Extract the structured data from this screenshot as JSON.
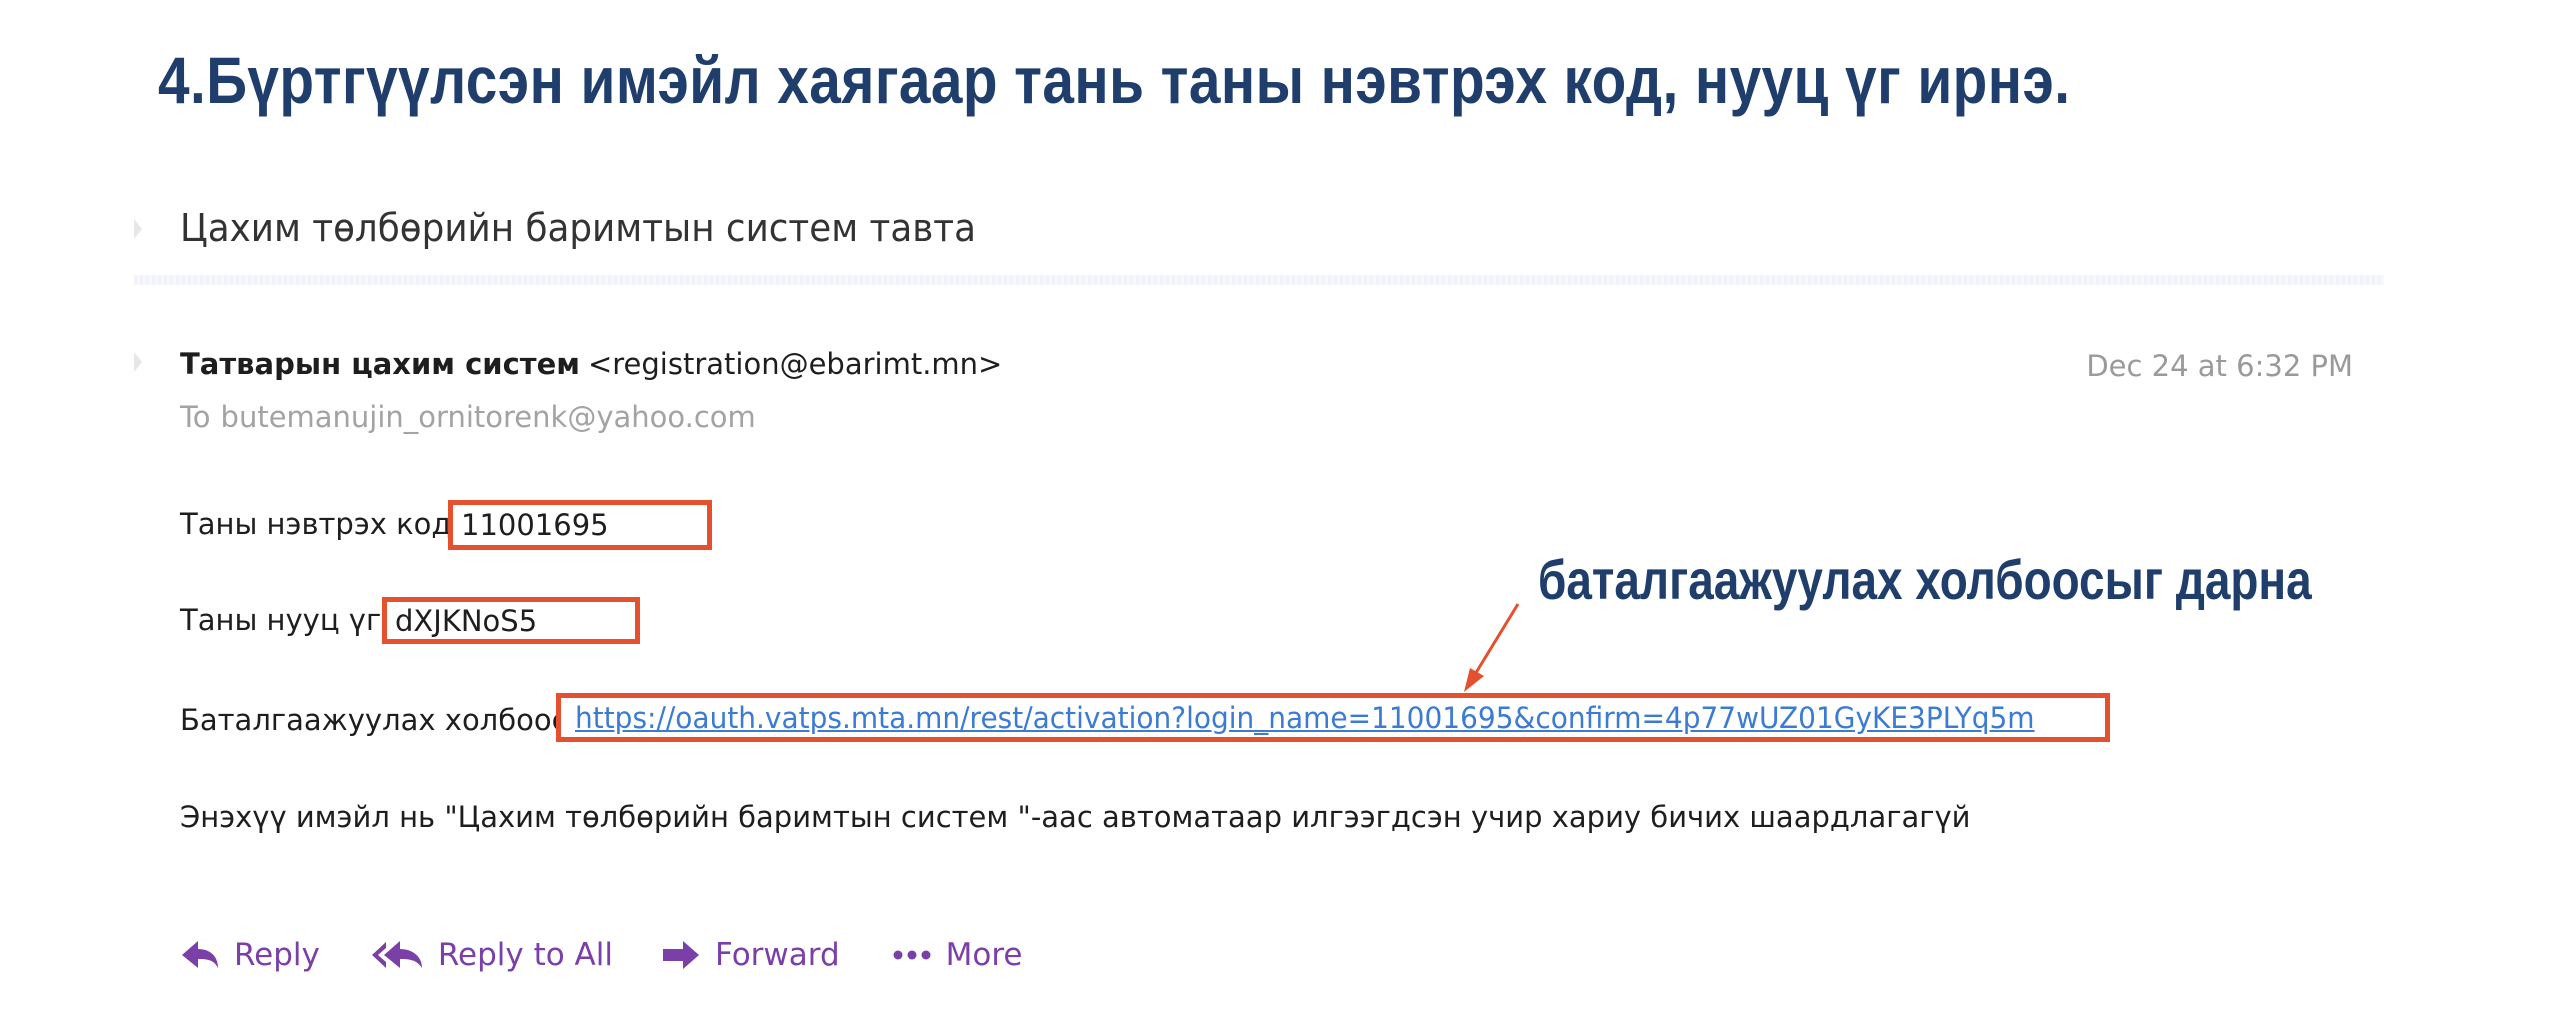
{
  "slide": {
    "heading": "4.Бүртгүүлсэн имэйл хаягаар тань таны нэвтрэх код, нууц үг ирнэ.",
    "annotation": "баталгаажуулах холбоосыг дарна"
  },
  "email": {
    "subject": "Цахим төлбөрийн баримтын систем тавта",
    "sender_name": "Татварын цахим систем",
    "sender_email": "<registration@ebarimt.mn>",
    "date": "Dec 24 at 6:32 PM",
    "to_label": "To",
    "to_address": "butemanujin_ornitorenk@yahoo.com",
    "login_label": "Таны нэвтрэх код:",
    "login_code": "11001695",
    "password_label": "Таны нууц үг:",
    "password": "dXJKNoS5",
    "confirm_label": "Баталгаажуулах холбоос",
    "confirm_link": "https://oauth.vatps.mta.mn/rest/activation?login_name=11001695&confirm=4p77wUZ01GyKE3PLYq5m",
    "notice": "Энэхүү имэйл нь \"Цахим төлбөрийн баримтын систем \"-аас автоматаар илгээгдсэн учир хариу бичих шаардлагагүй"
  },
  "actions": {
    "reply": "Reply",
    "reply_all": "Reply to All",
    "forward": "Forward",
    "more": "More"
  },
  "colors": {
    "heading": "#1f3e6c",
    "highlight": "#e5502f",
    "link": "#3b7bd2",
    "action": "#7b3fa8"
  },
  "icons": {
    "reply": "reply-icon",
    "reply_all": "reply-all-icon",
    "forward": "forward-icon",
    "more": "more-dots-icon"
  }
}
